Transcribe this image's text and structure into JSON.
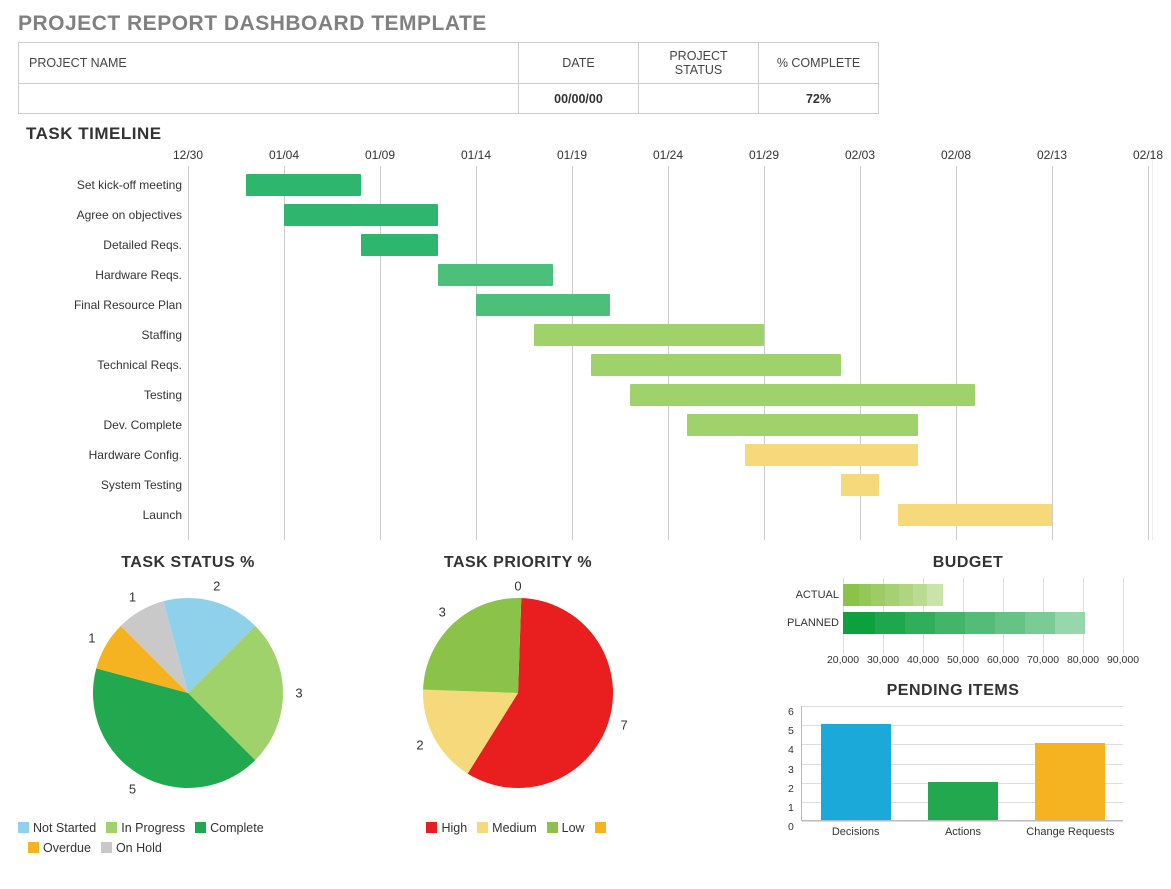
{
  "title": "PROJECT REPORT DASHBOARD TEMPLATE",
  "header": {
    "labels": {
      "project_name": "PROJECT NAME",
      "date": "DATE",
      "status": "PROJECT  STATUS",
      "pct": "% COMPLETE"
    },
    "values": {
      "project_name": "",
      "date": "00/00/00",
      "status": "",
      "pct": "72%"
    }
  },
  "sections": {
    "timeline": "TASK TIMELINE",
    "status": "TASK STATUS %",
    "priority": "TASK PRIORITY %",
    "budget": "BUDGET",
    "pending": "PENDING ITEMS"
  },
  "colors": {
    "gantt_dark": "#2eb66f",
    "gantt_mid": "#4cc07b",
    "gantt_lite": "#9fd26a",
    "gantt_yel": "#f6d97a",
    "not_started": "#8fd1ea",
    "in_progress": "#9fd26a",
    "complete": "#22a94f",
    "overdue": "#f6b321",
    "on_hold": "#c9c9c9",
    "high": "#e91e1e",
    "med": "#f6d97a",
    "low": "#8bc34a",
    "blank": "#f6b321",
    "pend_blue": "#1ba9d9",
    "pend_green": "#22a94f",
    "pend_gold": "#f6b321"
  },
  "gantt": {
    "range_days": 50,
    "ticks": [
      {
        "label": "12/30",
        "day": 0
      },
      {
        "label": "01/04",
        "day": 5
      },
      {
        "label": "01/09",
        "day": 10
      },
      {
        "label": "01/14",
        "day": 15
      },
      {
        "label": "01/19",
        "day": 20
      },
      {
        "label": "01/24",
        "day": 25
      },
      {
        "label": "01/29",
        "day": 30
      },
      {
        "label": "02/03",
        "day": 35
      },
      {
        "label": "02/08",
        "day": 40
      },
      {
        "label": "02/13",
        "day": 45
      },
      {
        "label": "02/18",
        "day": 50
      }
    ],
    "tasks": [
      {
        "name": "Set kick-off meeting",
        "start": 3,
        "dur": 6,
        "color": "gantt_dark"
      },
      {
        "name": "Agree on objectives",
        "start": 5,
        "dur": 8,
        "color": "gantt_dark"
      },
      {
        "name": "Detailed Reqs.",
        "start": 9,
        "dur": 4,
        "color": "gantt_dark"
      },
      {
        "name": "Hardware Reqs.",
        "start": 13,
        "dur": 6,
        "color": "gantt_mid"
      },
      {
        "name": "Final Resource Plan",
        "start": 15,
        "dur": 7,
        "color": "gantt_mid"
      },
      {
        "name": "Staffing",
        "start": 18,
        "dur": 12,
        "color": "gantt_lite"
      },
      {
        "name": "Technical Reqs.",
        "start": 21,
        "dur": 13,
        "color": "gantt_lite"
      },
      {
        "name": "Testing",
        "start": 23,
        "dur": 18,
        "color": "gantt_lite"
      },
      {
        "name": "Dev. Complete",
        "start": 26,
        "dur": 12,
        "color": "gantt_lite"
      },
      {
        "name": "Hardware Config.",
        "start": 29,
        "dur": 9,
        "color": "gantt_yel"
      },
      {
        "name": "System Testing",
        "start": 34,
        "dur": 2,
        "color": "gantt_yel"
      },
      {
        "name": "Launch",
        "start": 37,
        "dur": 8,
        "color": "gantt_yel"
      }
    ]
  },
  "status_pie": {
    "slices": [
      {
        "label": "Not Started",
        "value": 2,
        "color": "not_started"
      },
      {
        "label": "In Progress",
        "value": 3,
        "color": "in_progress"
      },
      {
        "label": "Complete",
        "value": 5,
        "color": "complete"
      },
      {
        "label": "Overdue",
        "value": 1,
        "color": "overdue"
      },
      {
        "label": "On Hold",
        "value": 1,
        "color": "on_hold"
      }
    ],
    "legend": [
      [
        "Not Started",
        "not_started"
      ],
      [
        "In Progress",
        "in_progress"
      ],
      [
        "Complete",
        "complete"
      ],
      [
        "Overdue",
        "overdue"
      ],
      [
        "On Hold",
        "on_hold"
      ]
    ]
  },
  "priority_pie": {
    "slices": [
      {
        "label": "High",
        "value": 7,
        "color": "high"
      },
      {
        "label": "Medium",
        "value": 2,
        "color": "med"
      },
      {
        "label": "Low",
        "value": 3,
        "color": "low"
      },
      {
        "label": "(blank)",
        "value": 0,
        "color": "blank"
      }
    ],
    "top_value": "0",
    "legend": [
      [
        "High",
        "high"
      ],
      [
        "Medium",
        "med"
      ],
      [
        "Low",
        "low"
      ],
      [
        "",
        "blank"
      ]
    ]
  },
  "budget": {
    "axis": [
      20000,
      30000,
      40000,
      50000,
      60000,
      70000,
      80000,
      90000
    ],
    "rows": [
      {
        "label": "ACTUAL",
        "total": 45000,
        "segments": [
          24000,
          27000,
          30500,
          34000,
          37500,
          41000,
          45000
        ],
        "palette": "lite"
      },
      {
        "label": "PLANNED",
        "total": 80500,
        "segments": [
          28000,
          35500,
          43000,
          50500,
          58000,
          65500,
          73000,
          80500
        ],
        "palette": "dark"
      }
    ]
  },
  "pending": {
    "ymax": 6,
    "yticks": [
      0,
      1,
      2,
      3,
      4,
      5,
      6
    ],
    "bars": [
      {
        "label": "Decisions",
        "value": 5,
        "color": "pend_blue"
      },
      {
        "label": "Actions",
        "value": 2,
        "color": "pend_green"
      },
      {
        "label": "Change Requests",
        "value": 4,
        "color": "pend_gold"
      }
    ]
  },
  "chart_data": [
    {
      "type": "bar",
      "subtype": "gantt",
      "title": "TASK TIMELINE",
      "x_start": "12/30",
      "x_end": "02/18",
      "xticks": [
        "12/30",
        "01/04",
        "01/09",
        "01/14",
        "01/19",
        "01/24",
        "01/29",
        "02/03",
        "02/08",
        "02/13",
        "02/18"
      ],
      "tasks": [
        {
          "name": "Set kick-off meeting",
          "start": "01/02",
          "end": "01/08"
        },
        {
          "name": "Agree on objectives",
          "start": "01/04",
          "end": "01/12"
        },
        {
          "name": "Detailed Reqs.",
          "start": "01/08",
          "end": "01/12"
        },
        {
          "name": "Hardware Reqs.",
          "start": "01/12",
          "end": "01/18"
        },
        {
          "name": "Final Resource Plan",
          "start": "01/14",
          "end": "01/21"
        },
        {
          "name": "Staffing",
          "start": "01/17",
          "end": "01/29"
        },
        {
          "name": "Technical Reqs.",
          "start": "01/20",
          "end": "02/02"
        },
        {
          "name": "Testing",
          "start": "01/22",
          "end": "02/09"
        },
        {
          "name": "Dev. Complete",
          "start": "01/25",
          "end": "02/06"
        },
        {
          "name": "Hardware Config.",
          "start": "01/28",
          "end": "02/06"
        },
        {
          "name": "System Testing",
          "start": "02/02",
          "end": "02/04"
        },
        {
          "name": "Launch",
          "start": "02/05",
          "end": "02/13"
        }
      ]
    },
    {
      "type": "pie",
      "title": "TASK STATUS %",
      "categories": [
        "Not Started",
        "In Progress",
        "Complete",
        "Overdue",
        "On Hold"
      ],
      "values": [
        2,
        3,
        5,
        1,
        1
      ]
    },
    {
      "type": "pie",
      "title": "TASK PRIORITY %",
      "categories": [
        "High",
        "Medium",
        "Low",
        "(blank)"
      ],
      "values": [
        7,
        2,
        3,
        0
      ]
    },
    {
      "type": "bar",
      "orientation": "horizontal",
      "title": "BUDGET",
      "categories": [
        "ACTUAL",
        "PLANNED"
      ],
      "values": [
        45000,
        80500
      ],
      "xlim": [
        20000,
        90000
      ],
      "xticks": [
        20000,
        30000,
        40000,
        50000,
        60000,
        70000,
        80000,
        90000
      ]
    },
    {
      "type": "bar",
      "title": "PENDING ITEMS",
      "categories": [
        "Decisions",
        "Actions",
        "Change Requests"
      ],
      "values": [
        5,
        2,
        4
      ],
      "ylim": [
        0,
        6
      ]
    }
  ]
}
